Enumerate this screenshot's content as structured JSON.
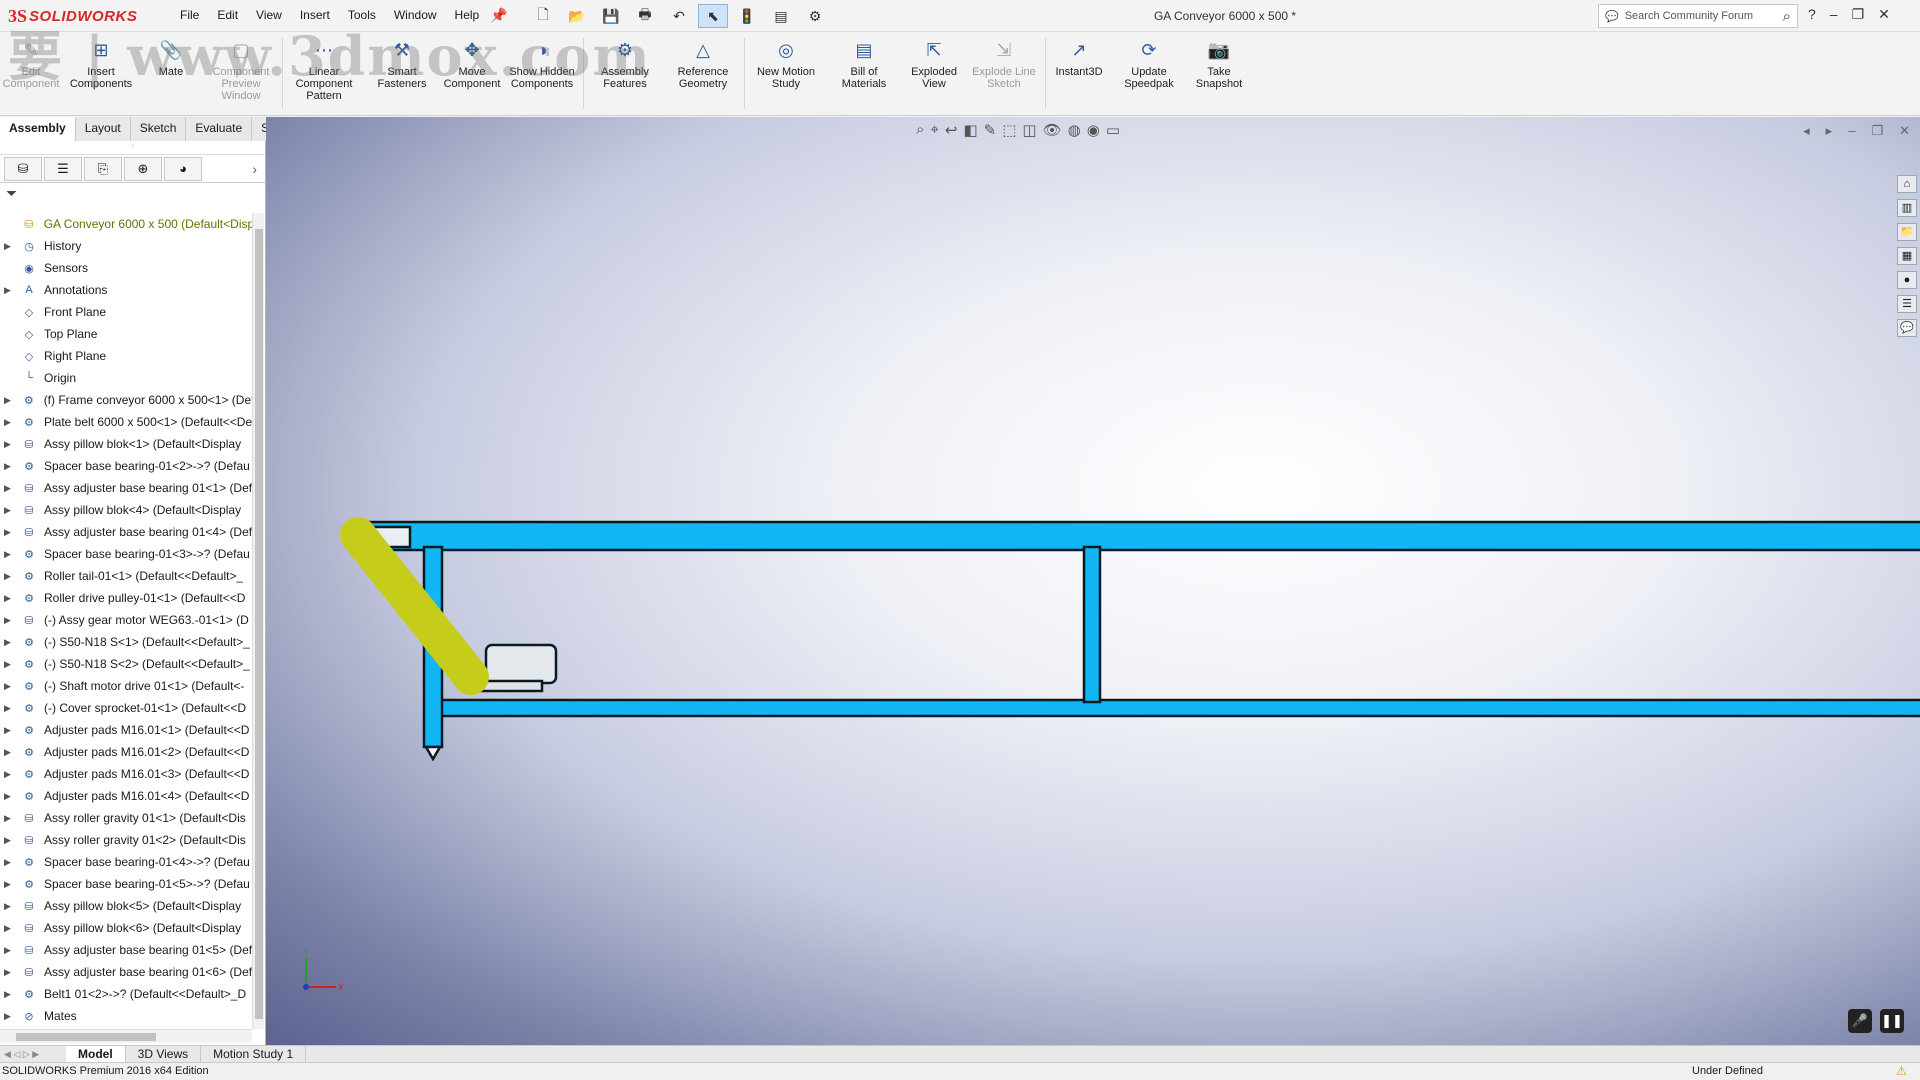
{
  "app": {
    "brand_mark": "3S",
    "brand": "SOLIDWORKS"
  },
  "menus": [
    "File",
    "Edit",
    "View",
    "Insert",
    "Tools",
    "Window",
    "Help"
  ],
  "document_title": "GA Conveyor 6000 x 500 *",
  "search": {
    "placeholder": "Search Community Forum"
  },
  "ribbon": [
    {
      "label": "Edit Component",
      "icon": "edit-component-icon",
      "disabled": true
    },
    {
      "label": "Insert Components",
      "icon": "insert-components-icon",
      "disabled": false
    },
    {
      "label": "Mate",
      "icon": "mate-icon",
      "disabled": false
    },
    {
      "label": "Component Preview Window",
      "icon": "preview-window-icon",
      "disabled": true
    },
    {
      "label": "Linear Component Pattern",
      "icon": "linear-pattern-icon",
      "disabled": false
    },
    {
      "label": "Smart Fasteners",
      "icon": "smart-fasteners-icon",
      "disabled": false
    },
    {
      "label": "Move Component",
      "icon": "move-component-icon",
      "disabled": false
    },
    {
      "label": "Show Hidden Components",
      "icon": "show-hidden-icon",
      "disabled": false
    },
    {
      "label": "Assembly Features",
      "icon": "assembly-features-icon",
      "disabled": false
    },
    {
      "label": "Reference Geometry",
      "icon": "reference-geometry-icon",
      "disabled": false
    },
    {
      "label": "New Motion Study",
      "icon": "motion-study-icon",
      "disabled": false
    },
    {
      "label": "Bill of Materials",
      "icon": "bom-icon",
      "disabled": false
    },
    {
      "label": "Exploded View",
      "icon": "exploded-view-icon",
      "disabled": false
    },
    {
      "label": "Explode Line Sketch",
      "icon": "explode-line-icon",
      "disabled": true
    },
    {
      "label": "Instant3D",
      "icon": "instant3d-icon",
      "disabled": false
    },
    {
      "label": "Update Speedpak",
      "icon": "speedpak-icon",
      "disabled": false
    },
    {
      "label": "Take Snapshot",
      "icon": "snapshot-icon",
      "disabled": false
    }
  ],
  "command_tabs": [
    "Assembly",
    "Layout",
    "Sketch",
    "Evaluate",
    "SOLIDWORKS Add-Ins",
    "SOLIDWORKS MBD"
  ],
  "active_command_tab": "Assembly",
  "tree": [
    {
      "label": "GA Conveyor 6000 x 500  (Default<Disp",
      "icon": "assembly-icon",
      "expand": false,
      "root": true
    },
    {
      "label": "History",
      "icon": "history-icon",
      "expand": true
    },
    {
      "label": "Sensors",
      "icon": "sensors-icon",
      "expand": false
    },
    {
      "label": "Annotations",
      "icon": "annotations-icon",
      "expand": true
    },
    {
      "label": "Front Plane",
      "icon": "plane-icon",
      "expand": false
    },
    {
      "label": "Top Plane",
      "icon": "plane-icon",
      "expand": false
    },
    {
      "label": "Right Plane",
      "icon": "plane-icon",
      "expand": false
    },
    {
      "label": "Origin",
      "icon": "origin-icon",
      "expand": false
    },
    {
      "label": "(f) Frame conveyor 6000 x 500<1> (Def",
      "icon": "part-icon",
      "expand": true
    },
    {
      "label": "Plate belt 6000 x 500<1> (Default<<De",
      "icon": "part-icon",
      "expand": true
    },
    {
      "label": "Assy pillow blok<1> (Default<Display",
      "icon": "subassembly-icon",
      "expand": true
    },
    {
      "label": "Spacer base bearing-01<2>->? (Defau",
      "icon": "part-icon",
      "expand": true
    },
    {
      "label": "Assy adjuster base bearing 01<1> (Def",
      "icon": "subassembly-icon",
      "expand": true
    },
    {
      "label": "Assy pillow blok<4> (Default<Display",
      "icon": "subassembly-icon",
      "expand": true
    },
    {
      "label": "Assy adjuster base bearing 01<4> (Def",
      "icon": "subassembly-icon",
      "expand": true
    },
    {
      "label": "Spacer base bearing-01<3>->? (Defau",
      "icon": "part-icon",
      "expand": true
    },
    {
      "label": "Roller tail-01<1> (Default<<Default>_",
      "icon": "part-icon",
      "expand": true
    },
    {
      "label": "Roller drive pulley-01<1> (Default<<D",
      "icon": "part-icon",
      "expand": true
    },
    {
      "label": "(-) Assy gear motor WEG63.-01<1> (D",
      "icon": "subassembly-icon",
      "expand": true
    },
    {
      "label": "(-) S50-N18 S<1> (Default<<Default>_",
      "icon": "part-icon",
      "expand": true
    },
    {
      "label": "(-) S50-N18 S<2> (Default<<Default>_",
      "icon": "part-icon",
      "expand": true
    },
    {
      "label": "(-) Shaft motor drive 01<1> (Default<-",
      "icon": "part-icon",
      "expand": true
    },
    {
      "label": "(-) Cover sprocket-01<1> (Default<<D",
      "icon": "part-icon",
      "expand": true
    },
    {
      "label": "Adjuster pads M16.01<1> (Default<<D",
      "icon": "part-icon",
      "expand": true
    },
    {
      "label": "Adjuster pads M16.01<2> (Default<<D",
      "icon": "part-icon",
      "expand": true
    },
    {
      "label": "Adjuster pads M16.01<3> (Default<<D",
      "icon": "part-icon",
      "expand": true
    },
    {
      "label": "Adjuster pads M16.01<4> (Default<<D",
      "icon": "part-icon",
      "expand": true
    },
    {
      "label": "Assy roller gravity 01<1> (Default<Dis",
      "icon": "subassembly-icon",
      "expand": true
    },
    {
      "label": "Assy roller gravity 01<2> (Default<Dis",
      "icon": "subassembly-icon",
      "expand": true
    },
    {
      "label": "Spacer base bearing-01<4>->? (Defau",
      "icon": "part-icon",
      "expand": true
    },
    {
      "label": "Spacer base bearing-01<5>->? (Defau",
      "icon": "part-icon",
      "expand": true
    },
    {
      "label": "Assy pillow blok<5> (Default<Display",
      "icon": "subassembly-icon",
      "expand": true
    },
    {
      "label": "Assy pillow blok<6> (Default<Display",
      "icon": "subassembly-icon",
      "expand": true
    },
    {
      "label": "Assy adjuster base bearing 01<5> (Def",
      "icon": "subassembly-icon",
      "expand": true
    },
    {
      "label": "Assy adjuster base bearing 01<6> (Def",
      "icon": "subassembly-icon",
      "expand": true
    },
    {
      "label": "Belt1 01<2>->? (Default<<Default>_D",
      "icon": "part-icon",
      "expand": true
    },
    {
      "label": "Mates",
      "icon": "mates-icon",
      "expand": true
    }
  ],
  "bottom_tabs": [
    "Model",
    "3D Views",
    "Motion Study 1"
  ],
  "active_bottom_tab": "Model",
  "status": {
    "edition": "SOLIDWORKS Premium 2016 x64 Edition",
    "state": "Under Defined"
  },
  "triad": {
    "x_label": "X",
    "y_label": "Y"
  },
  "watermark": "要 | www.3dmox.com",
  "colors": {
    "frame": "#12b6f5",
    "belt_guard": "#c6cc1a",
    "brand": "#d8262b"
  }
}
